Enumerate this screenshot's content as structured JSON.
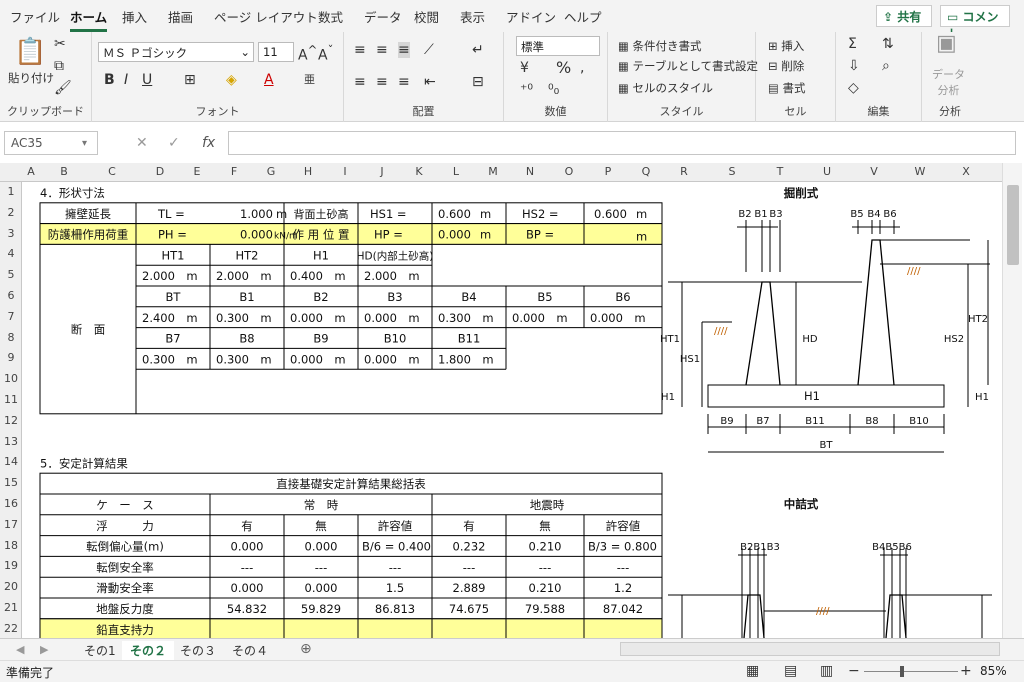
{
  "tabs": [
    "ファイル",
    "ホーム",
    "挿入",
    "描画",
    "ページ レイアウト",
    "数式",
    "データ",
    "校閲",
    "表示",
    "アドイン",
    "ヘルプ"
  ],
  "share_label": "共有",
  "comment_label": "コメント",
  "ribbon": {
    "clipboard_label": "クリップボード",
    "paste_label": "貼り付け",
    "font_label": "フォント",
    "font_name": "ＭＳ Ｐゴシック",
    "font_size": "11",
    "align_label": "配置",
    "number_label": "数値",
    "number_format": "標準",
    "cond_format": "条件付き書式",
    "table_format": "テーブルとして書式設定",
    "cell_style": "セルのスタイル",
    "style_label": "スタイル",
    "insert": "挿入",
    "delete": "削除",
    "format": "書式",
    "cells_label": "セル",
    "edit_label": "編集",
    "analyze": "データ\n分析",
    "analyze_label": "分析"
  },
  "namebox": "AC35",
  "columns": [
    "A",
    "B",
    "C",
    "D",
    "E",
    "F",
    "G",
    "H",
    "I",
    "J",
    "K",
    "L",
    "M",
    "N",
    "O",
    "P",
    "Q",
    "R",
    "S",
    "T",
    "U",
    "V",
    "W",
    "X"
  ],
  "rows": [
    "1",
    "2",
    "3",
    "4",
    "5",
    "6",
    "7",
    "8",
    "9",
    "10",
    "11",
    "12",
    "13",
    "14",
    "15",
    "16",
    "17",
    "18",
    "19",
    "20",
    "21",
    "22"
  ],
  "sheet": {
    "sec4": "4．形状寸法",
    "r2": {
      "a": "擁壁延長",
      "b": "TL =",
      "c": "1.000",
      "d": "m",
      "e": "背面土砂高",
      "f": "HS1 =",
      "g": "0.600",
      "h": "m",
      "i": "HS2 =",
      "j": "0.600",
      "k": "m"
    },
    "r3": {
      "a": "防護柵作用荷重",
      "b": "PH =",
      "c": "0.000",
      "d": "kN/m",
      "e": "作 用 位 置",
      "f": "HP =",
      "g": "0.000",
      "h": "m",
      "i": "BP =",
      "k": "m"
    },
    "section_label": "断　面",
    "r4": [
      "HT1",
      "HT2",
      "H1",
      "HD(内部土砂高)"
    ],
    "r5": [
      "2.000　m",
      "2.000　m",
      "0.400　m",
      "2.000　m"
    ],
    "r6": [
      "BT",
      "B1",
      "B2",
      "B3",
      "B4",
      "B5",
      "B6"
    ],
    "r7": [
      "2.400　m",
      "0.300　m",
      "0.000　m",
      "0.000　m",
      "0.300　m",
      "0.000　m",
      "0.000　m"
    ],
    "r8": [
      "B7",
      "B8",
      "B9",
      "B10",
      "B11"
    ],
    "r9": [
      "0.300　m",
      "0.300　m",
      "0.000　m",
      "0.000　m",
      "1.800　m"
    ],
    "sec5": "5．安定計算結果",
    "t_title": "直接基礎安定計算結果総括表",
    "case": "ケ　ー　ス",
    "normal": "常　時",
    "quake": "地震時",
    "buoy": "浮　　　力",
    "hdr": [
      "有",
      "無",
      "許容値",
      "有",
      "無",
      "許容値"
    ],
    "results": [
      {
        "label": "転倒偏心量(m)",
        "v": [
          "0.000",
          "0.000",
          "B/6 = 0.400",
          "0.232",
          "0.210",
          "B/3 = 0.800"
        ]
      },
      {
        "label": "転倒安全率",
        "v": [
          "---",
          "---",
          "---",
          "---",
          "---",
          "---"
        ]
      },
      {
        "label": "滑動安全率",
        "v": [
          "0.000",
          "0.000",
          "1.5",
          "2.889",
          "0.210",
          "1.2"
        ]
      },
      {
        "label": "地盤反力度",
        "v": [
          "54.832",
          "59.829",
          "86.813",
          "74.675",
          "79.588",
          "87.042"
        ]
      },
      {
        "label": "鉛直支持力",
        "v": [
          "",
          "",
          "",
          "",
          "",
          ""
        ]
      }
    ]
  },
  "diagram": {
    "title1": "掘削式",
    "title2": "中詰式",
    "lbl": {
      "b2": "B2",
      "b1": "B1",
      "b3": "B3",
      "b5": "B5",
      "b4": "B4",
      "b6": "B6",
      "ht1": "HT1",
      "hs1": "HS1",
      "h1": "H1",
      "hd": "HD",
      "ht2": "HT2",
      "hs2": "HS2",
      "h1b": "H1",
      "h1c": "H1",
      "b9": "B9",
      "b7": "B7",
      "b11": "B11",
      "b8": "B8",
      "b10": "B10",
      "bt": "BT",
      "b2b1b3": "B2B1B3",
      "b4b5b6": "B4B5B6"
    }
  },
  "sheet_tabs": [
    "その1",
    "その２",
    "その３",
    "その４"
  ],
  "status_text": "準備完了",
  "zoom": "85%",
  "accent": "#217346",
  "highlight": "#ffff99"
}
